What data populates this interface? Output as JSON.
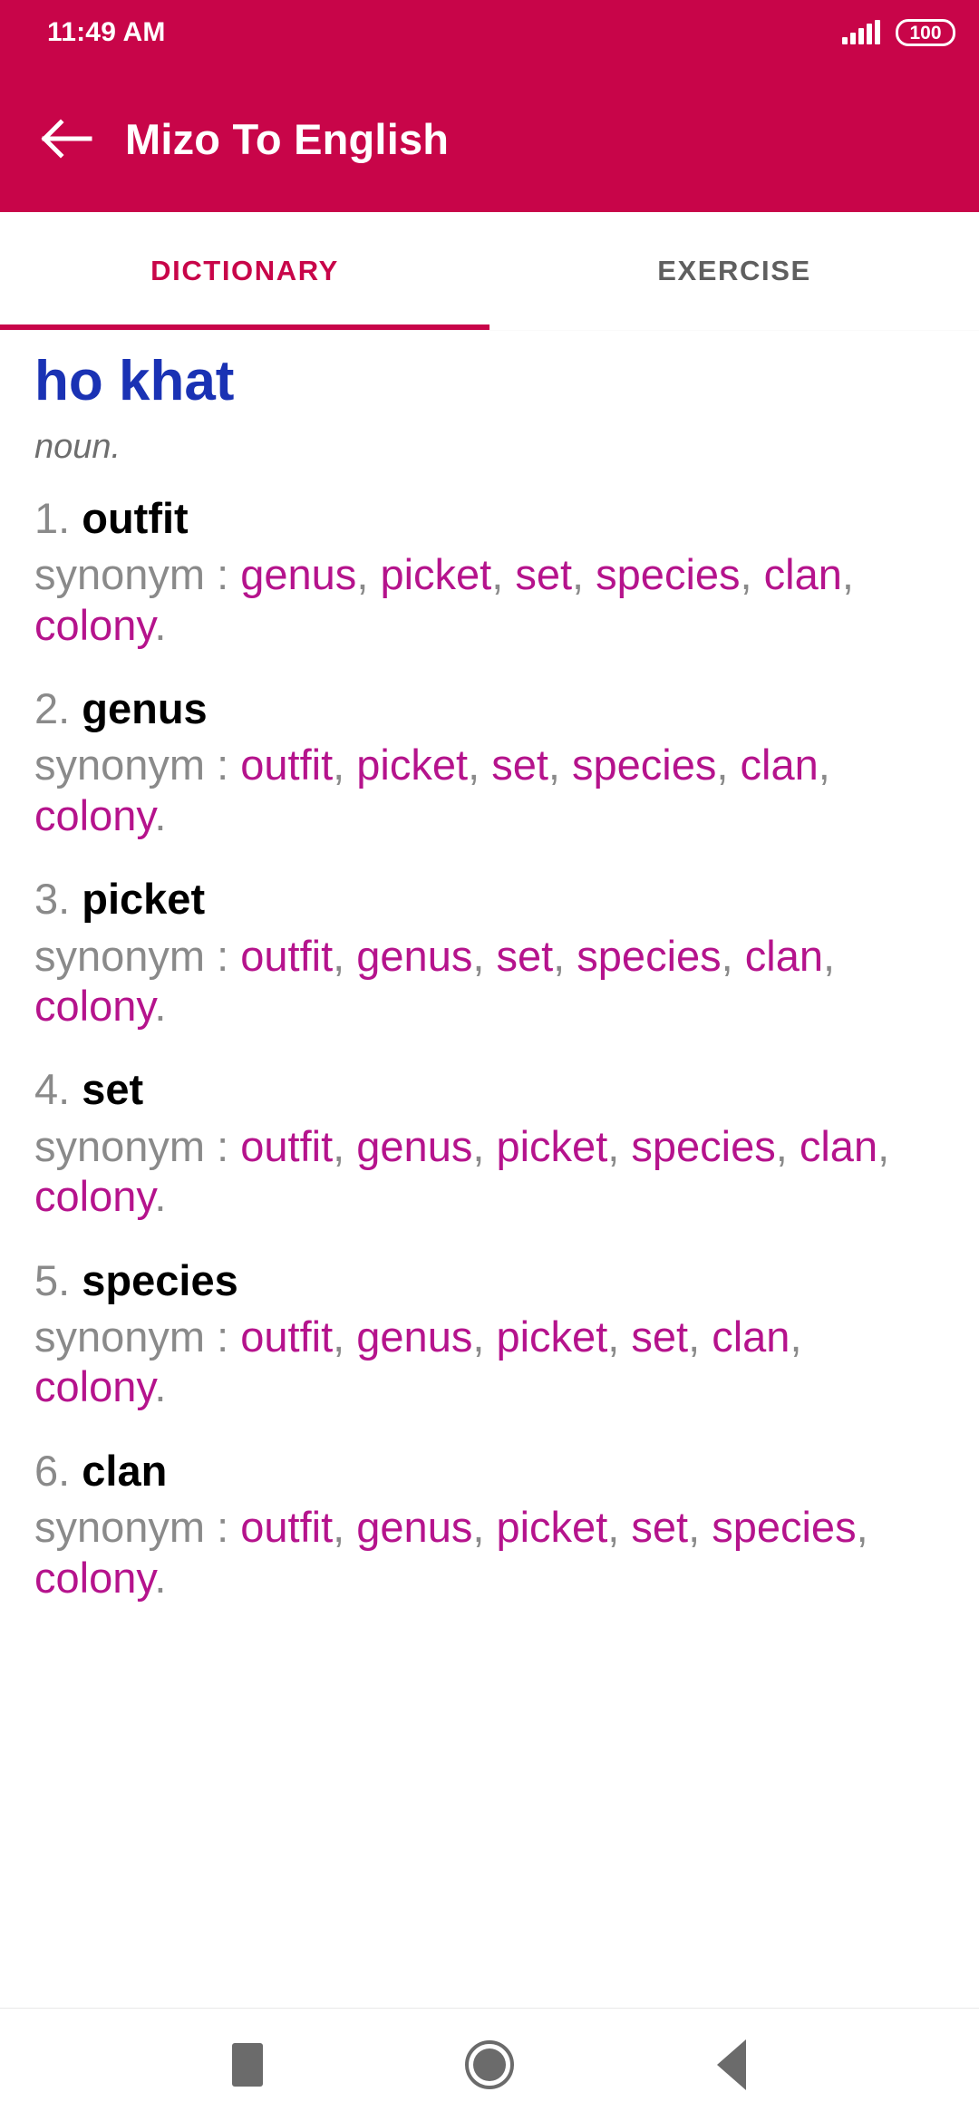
{
  "colors": {
    "brand": "#c80549",
    "headword": "#1a32b4",
    "synonym": "#b5138c",
    "muted": "#8a8a8a",
    "nav_icon": "#6b6b6b"
  },
  "status_bar": {
    "clock": "11:49 AM",
    "battery_level": "100",
    "signal_icon": "signal-bars-icon",
    "battery_icon": "battery-icon"
  },
  "app_bar": {
    "back_icon": "back-arrow-icon",
    "title": "Mizo To English"
  },
  "tabs": [
    {
      "label": "DICTIONARY",
      "active": true
    },
    {
      "label": "EXERCISE",
      "active": false
    }
  ],
  "dictionary": {
    "headword": "ho khat",
    "part_of_speech": "noun.",
    "synonym_label": "synonym : ",
    "separator": ", ",
    "terminator": ".",
    "entries": [
      {
        "number": "1.",
        "word": "outfit",
        "synonyms": [
          "genus",
          "picket",
          "set",
          "species",
          "clan",
          "colony"
        ]
      },
      {
        "number": "2.",
        "word": "genus",
        "synonyms": [
          "outfit",
          "picket",
          "set",
          "species",
          "clan",
          "colony"
        ]
      },
      {
        "number": "3.",
        "word": "picket",
        "synonyms": [
          "outfit",
          "genus",
          "set",
          "species",
          "clan",
          "colony"
        ]
      },
      {
        "number": "4.",
        "word": "set",
        "synonyms": [
          "outfit",
          "genus",
          "picket",
          "species",
          "clan",
          "colony"
        ]
      },
      {
        "number": "5.",
        "word": "species",
        "synonyms": [
          "outfit",
          "genus",
          "picket",
          "set",
          "clan",
          "colony"
        ]
      },
      {
        "number": "6.",
        "word": "clan",
        "synonyms": [
          "outfit",
          "genus",
          "picket",
          "set",
          "species",
          "colony"
        ]
      }
    ]
  },
  "nav_bar": {
    "recents_icon": "square-recents-icon",
    "home_icon": "circle-home-icon",
    "back_icon": "triangle-back-icon"
  }
}
